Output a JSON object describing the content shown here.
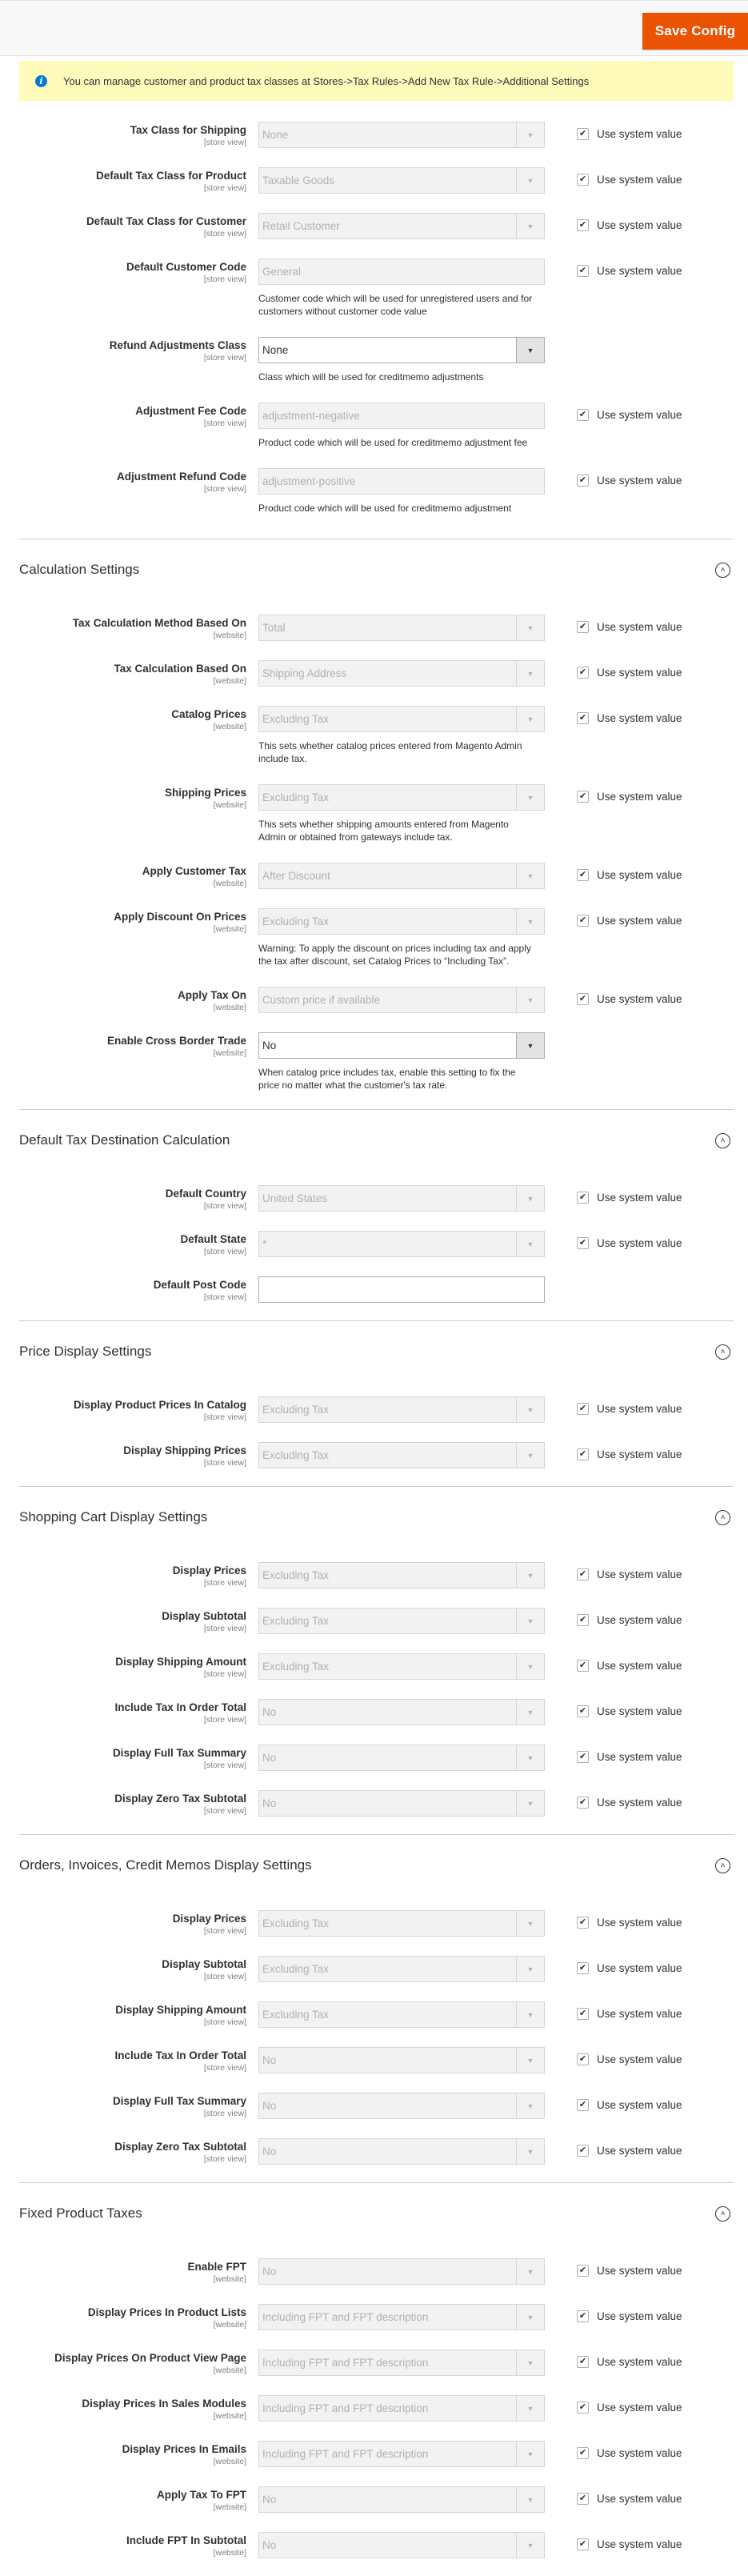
{
  "toolbar": {
    "save_label": "Save Config",
    "accent_color": "#eb5202"
  },
  "notice": {
    "icon": "info-icon",
    "text": "You can manage customer and product tax classes at Stores->Tax Rules->Add New Tax Rule->Additional Settings"
  },
  "use_system_label": "Use system value",
  "tax_classes": {
    "rows": [
      {
        "label": "Tax Class for Shipping",
        "scope": "[store view]",
        "type": "select",
        "value": "None",
        "disabled": true,
        "use_system": true,
        "comment": ""
      },
      {
        "label": "Default Tax Class for Product",
        "scope": "[store view]",
        "type": "select",
        "value": "Taxable Goods",
        "disabled": true,
        "use_system": true,
        "comment": ""
      },
      {
        "label": "Default Tax Class for Customer",
        "scope": "[store view]",
        "type": "select",
        "value": "Retail Customer",
        "disabled": true,
        "use_system": true,
        "comment": ""
      },
      {
        "label": "Default Customer Code",
        "scope": "[store view]",
        "type": "text",
        "value": "General",
        "disabled": true,
        "use_system": true,
        "comment": "Customer code which will be used for unregistered users and for customers without customer code value"
      },
      {
        "label": "Refund Adjustments Class",
        "scope": "[store view]",
        "type": "select",
        "value": "None",
        "disabled": false,
        "use_system": null,
        "comment": "Class which will be used for creditmemo adjustments"
      },
      {
        "label": "Adjustment Fee Code",
        "scope": "[store view]",
        "type": "text",
        "value": "adjustment-negative",
        "disabled": true,
        "use_system": true,
        "comment": "Product code which will be used for creditmemo adjustment fee"
      },
      {
        "label": "Adjustment Refund Code",
        "scope": "[store view]",
        "type": "text",
        "value": "adjustment-positive",
        "disabled": true,
        "use_system": true,
        "comment": "Product code which will be used for creditmemo adjustment"
      }
    ]
  },
  "sections": [
    {
      "title": "Calculation Settings",
      "rows": [
        {
          "label": "Tax Calculation Method Based On",
          "scope": "[website]",
          "type": "select",
          "value": "Total",
          "disabled": true,
          "use_system": true,
          "comment": ""
        },
        {
          "label": "Tax Calculation Based On",
          "scope": "[website]",
          "type": "select",
          "value": "Shipping Address",
          "disabled": true,
          "use_system": true,
          "comment": ""
        },
        {
          "label": "Catalog Prices",
          "scope": "[website]",
          "type": "select",
          "value": "Excluding Tax",
          "disabled": true,
          "use_system": true,
          "comment": "This sets whether catalog prices entered from Magento Admin include tax."
        },
        {
          "label": "Shipping Prices",
          "scope": "[website]",
          "type": "select",
          "value": "Excluding Tax",
          "disabled": true,
          "use_system": true,
          "comment": "This sets whether shipping amounts entered from Magento Admin or obtained from gateways include tax."
        },
        {
          "label": "Apply Customer Tax",
          "scope": "[website]",
          "type": "select",
          "value": "After Discount",
          "disabled": true,
          "use_system": true,
          "comment": ""
        },
        {
          "label": "Apply Discount On Prices",
          "scope": "[website]",
          "type": "select",
          "value": "Excluding Tax",
          "disabled": true,
          "use_system": true,
          "comment": "Warning: To apply the discount on prices including tax and apply the tax after discount, set Catalog Prices to “Including Tax”."
        },
        {
          "label": "Apply Tax On",
          "scope": "[website]",
          "type": "select",
          "value": "Custom price if available",
          "disabled": true,
          "use_system": true,
          "comment": ""
        },
        {
          "label": "Enable Cross Border Trade",
          "scope": "[website]",
          "type": "select",
          "value": "No",
          "disabled": false,
          "use_system": null,
          "comment": "When catalog price includes tax, enable this setting to fix the price no matter what the customer's tax rate."
        }
      ]
    },
    {
      "title": "Default Tax Destination Calculation",
      "rows": [
        {
          "label": "Default Country",
          "scope": "[store view]",
          "type": "select",
          "value": "United States",
          "disabled": true,
          "use_system": true,
          "comment": ""
        },
        {
          "label": "Default State",
          "scope": "[store view]",
          "type": "select",
          "value": "*",
          "disabled": true,
          "use_system": true,
          "comment": ""
        },
        {
          "label": "Default Post Code",
          "scope": "[store view]",
          "type": "text",
          "value": "",
          "disabled": false,
          "use_system": null,
          "comment": ""
        }
      ]
    },
    {
      "title": "Price Display Settings",
      "rows": [
        {
          "label": "Display Product Prices In Catalog",
          "scope": "[store view]",
          "type": "select",
          "value": "Excluding Tax",
          "disabled": true,
          "use_system": true,
          "comment": ""
        },
        {
          "label": "Display Shipping Prices",
          "scope": "[store view]",
          "type": "select",
          "value": "Excluding Tax",
          "disabled": true,
          "use_system": true,
          "comment": ""
        }
      ]
    },
    {
      "title": "Shopping Cart Display Settings",
      "rows": [
        {
          "label": "Display Prices",
          "scope": "[store view]",
          "type": "select",
          "value": "Excluding Tax",
          "disabled": true,
          "use_system": true,
          "comment": ""
        },
        {
          "label": "Display Subtotal",
          "scope": "[store view]",
          "type": "select",
          "value": "Excluding Tax",
          "disabled": true,
          "use_system": true,
          "comment": ""
        },
        {
          "label": "Display Shipping Amount",
          "scope": "[store view]",
          "type": "select",
          "value": "Excluding Tax",
          "disabled": true,
          "use_system": true,
          "comment": ""
        },
        {
          "label": "Include Tax In Order Total",
          "scope": "[store view]",
          "type": "select",
          "value": "No",
          "disabled": true,
          "use_system": true,
          "comment": ""
        },
        {
          "label": "Display Full Tax Summary",
          "scope": "[store view]",
          "type": "select",
          "value": "No",
          "disabled": true,
          "use_system": true,
          "comment": ""
        },
        {
          "label": "Display Zero Tax Subtotal",
          "scope": "[store view]",
          "type": "select",
          "value": "No",
          "disabled": true,
          "use_system": true,
          "comment": ""
        }
      ]
    },
    {
      "title": "Orders, Invoices, Credit Memos Display Settings",
      "rows": [
        {
          "label": "Display Prices",
          "scope": "[store view]",
          "type": "select",
          "value": "Excluding Tax",
          "disabled": true,
          "use_system": true,
          "comment": ""
        },
        {
          "label": "Display Subtotal",
          "scope": "[store view]",
          "type": "select",
          "value": "Excluding Tax",
          "disabled": true,
          "use_system": true,
          "comment": ""
        },
        {
          "label": "Display Shipping Amount",
          "scope": "[store view]",
          "type": "select",
          "value": "Excluding Tax",
          "disabled": true,
          "use_system": true,
          "comment": ""
        },
        {
          "label": "Include Tax In Order Total",
          "scope": "[store view]",
          "type": "select",
          "value": "No",
          "disabled": true,
          "use_system": true,
          "comment": ""
        },
        {
          "label": "Display Full Tax Summary",
          "scope": "[store view]",
          "type": "select",
          "value": "No",
          "disabled": true,
          "use_system": true,
          "comment": ""
        },
        {
          "label": "Display Zero Tax Subtotal",
          "scope": "[store view]",
          "type": "select",
          "value": "No",
          "disabled": true,
          "use_system": true,
          "comment": ""
        }
      ]
    },
    {
      "title": "Fixed Product Taxes",
      "rows": [
        {
          "label": "Enable FPT",
          "scope": "[website]",
          "type": "select",
          "value": "No",
          "disabled": true,
          "use_system": true,
          "comment": ""
        },
        {
          "label": "Display Prices In Product Lists",
          "scope": "[website]",
          "type": "select",
          "value": "Including FPT and FPT description",
          "disabled": true,
          "use_system": true,
          "comment": ""
        },
        {
          "label": "Display Prices On Product View Page",
          "scope": "[website]",
          "type": "select",
          "value": "Including FPT and FPT description",
          "disabled": true,
          "use_system": true,
          "comment": ""
        },
        {
          "label": "Display Prices In Sales Modules",
          "scope": "[website]",
          "type": "select",
          "value": "Including FPT and FPT description",
          "disabled": true,
          "use_system": true,
          "comment": ""
        },
        {
          "label": "Display Prices In Emails",
          "scope": "[website]",
          "type": "select",
          "value": "Including FPT and FPT description",
          "disabled": true,
          "use_system": true,
          "comment": ""
        },
        {
          "label": "Apply Tax To FPT",
          "scope": "[website]",
          "type": "select",
          "value": "No",
          "disabled": true,
          "use_system": true,
          "comment": ""
        },
        {
          "label": "Include FPT In Subtotal",
          "scope": "[website]",
          "type": "select",
          "value": "No",
          "disabled": true,
          "use_system": true,
          "comment": ""
        }
      ]
    }
  ]
}
